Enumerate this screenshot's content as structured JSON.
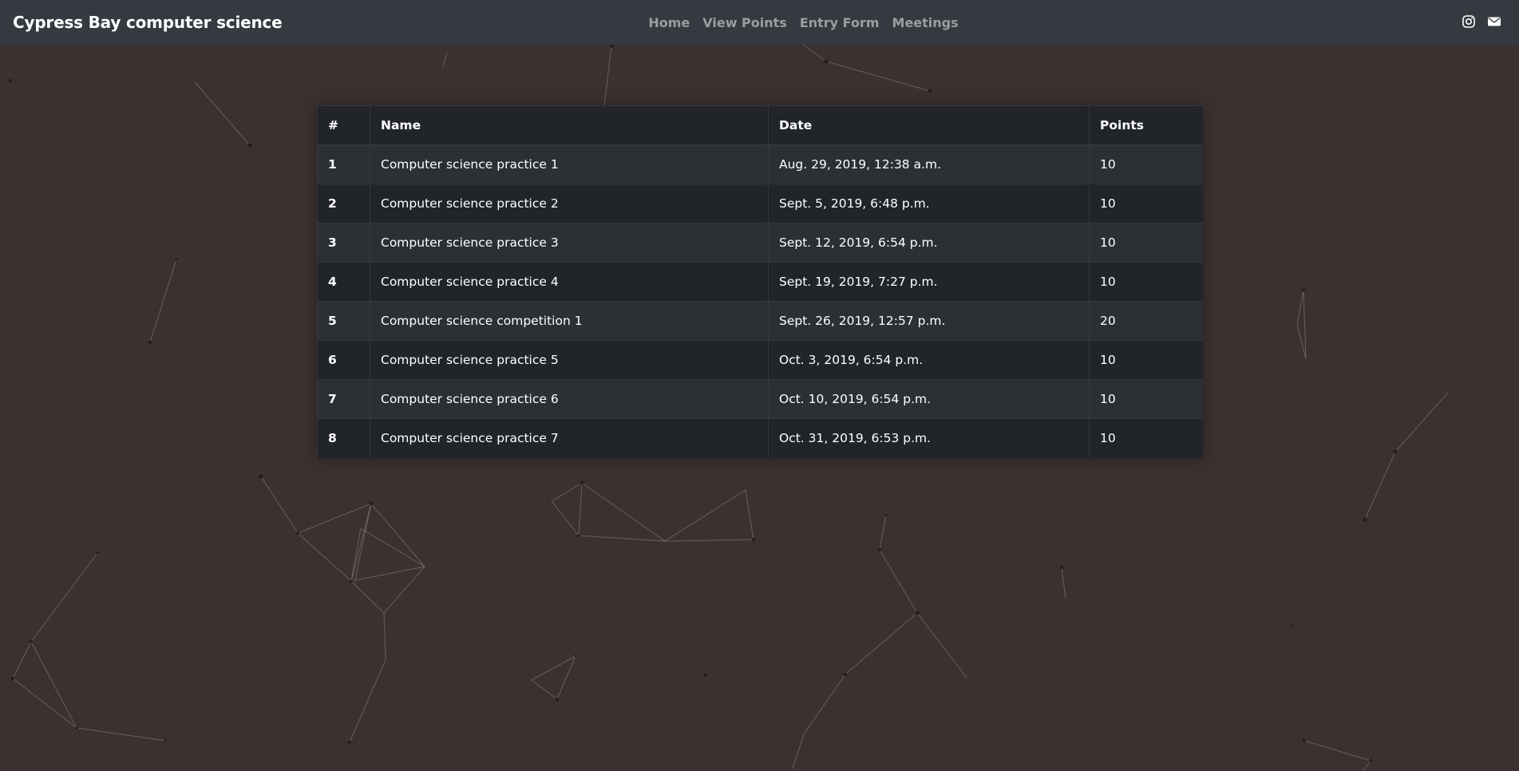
{
  "navbar": {
    "brand": "Cypress Bay computer science",
    "links": [
      "Home",
      "View Points",
      "Entry Form",
      "Meetings"
    ],
    "icons": [
      "instagram-icon",
      "email-icon"
    ]
  },
  "table": {
    "headers": [
      "#",
      "Name",
      "Date",
      "Points"
    ],
    "rows": [
      [
        "1",
        "Computer science practice 1",
        "Aug. 29, 2019, 12:38 a.m.",
        "10"
      ],
      [
        "2",
        "Computer science practice 2",
        "Sept. 5, 2019, 6:48 p.m.",
        "10"
      ],
      [
        "3",
        "Computer science practice 3",
        "Sept. 12, 2019, 6:54 p.m.",
        "10"
      ],
      [
        "4",
        "Computer science practice 4",
        "Sept. 19, 2019, 7:27 p.m.",
        "10"
      ],
      [
        "5",
        "Computer science competition 1",
        "Sept. 26, 2019, 12:57 p.m.",
        "20"
      ],
      [
        "6",
        "Computer science practice 5",
        "Oct. 3, 2019, 6:54 p.m.",
        "10"
      ],
      [
        "7",
        "Computer science practice 6",
        "Oct. 10, 2019, 6:54 p.m.",
        "10"
      ],
      [
        "8",
        "Computer science practice 7",
        "Oct. 31, 2019, 6:53 p.m.",
        "10"
      ]
    ]
  },
  "colors": {
    "background": "#3b3130",
    "navbar": "#343a40",
    "table_dark": "#212529",
    "table_stripe": "#2c3034"
  }
}
